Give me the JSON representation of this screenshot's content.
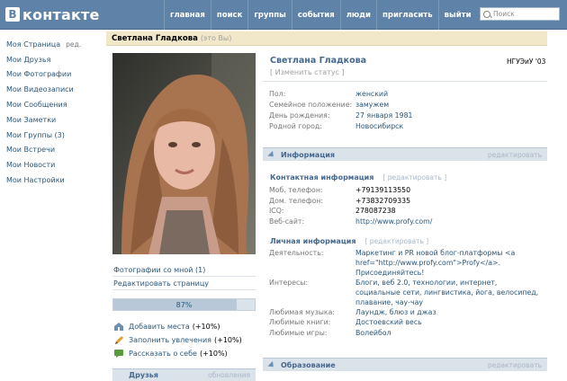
{
  "brand": {
    "mark": "В",
    "name": "контакте"
  },
  "nav": [
    "главная",
    "поиск",
    "группы",
    "события",
    "люди",
    "пригласить",
    "выйти"
  ],
  "search": {
    "placeholder": "Поиск"
  },
  "sidebar": {
    "items": [
      {
        "label": "Моя Страница",
        "edit": "ред."
      },
      {
        "label": "Мои Друзья"
      },
      {
        "label": "Мои Фотографии"
      },
      {
        "label": "Мои Видеозаписи"
      },
      {
        "label": "Мои Сообщения"
      },
      {
        "label": "Мои Заметки"
      },
      {
        "label": "Мои Группы (3)"
      },
      {
        "label": "Мои Встречи"
      },
      {
        "label": "Мои Новости"
      },
      {
        "label": "Мои Настройки"
      }
    ]
  },
  "page_header": {
    "name": "Светлана Гладкова",
    "you": "(это Вы)"
  },
  "photo_links": {
    "photos_with_me": "Фотографии со мной (1)",
    "edit_page": "Редактировать страницу"
  },
  "completion": {
    "value": 87,
    "label": "87%"
  },
  "tips": [
    {
      "label": "Добавить места",
      "pct": "(+10%)",
      "icon": "house-icon"
    },
    {
      "label": "Заполнить увлечения",
      "pct": "(+10%)",
      "icon": "pencil-icon"
    },
    {
      "label": "Рассказать о себе",
      "pct": "(+10%)",
      "icon": "speech-icon"
    }
  ],
  "friends_section": {
    "title": "Друзья",
    "edit": "обновления"
  },
  "profile": {
    "name": "Светлана Гладкова",
    "university": "НГУЭиУ '03",
    "status_edit": "[ Изменить статус ]",
    "basic": [
      {
        "key": "Пол:",
        "value": "женский"
      },
      {
        "key": "Семейное положение:",
        "value": "замужем"
      },
      {
        "key": "День рождения:",
        "value": "27 января 1981"
      },
      {
        "key": "Родной город:",
        "value": "Новосибирск"
      }
    ]
  },
  "info_section": {
    "title": "Информация",
    "edit": "редактировать"
  },
  "contact": {
    "title": "Контактная информация",
    "edit": "[ редактировать ]",
    "rows": [
      {
        "key": "Моб. телефон:",
        "value": "+79139113550"
      },
      {
        "key": "Дом. телефон:",
        "value": "+73832709335"
      },
      {
        "key": "ICQ:",
        "value": "278087238"
      },
      {
        "key": "Веб-сайт:",
        "value": "http://www.profy.com/"
      }
    ]
  },
  "personal": {
    "title": "Личная информация",
    "edit": "[ редактировать ]",
    "activity_key": "Деятельность:",
    "activity_value": "Маркетинг и PR новой блог-платформы <a href=\"http://www.profy.com\">Profy</a>. Присоединяйтесь!",
    "interests_key": "Интересы:",
    "interests_value": "Блоги, веб 2.0, технологии, интернет, социальные сети, лингвистика, йога, велосипед, плавание, чау-чау",
    "music_key": "Любимая музыка:",
    "music_value": "Лаундж, блюз и джаз",
    "books_key": "Любимые книги:",
    "books_value": "Достоевский весь",
    "games_key": "Любимые игры:",
    "games_value": "Волейбол"
  },
  "education_section": {
    "title": "Образование",
    "edit": "редактировать"
  }
}
